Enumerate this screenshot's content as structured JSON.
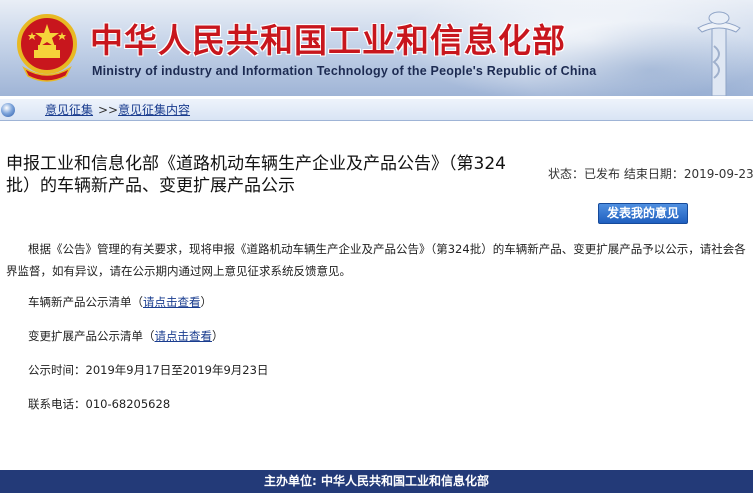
{
  "header": {
    "site_title": "中华人民共和国工业和信息化部",
    "site_subtitle": "Ministry of industry and Information Technology of the People's Republic of China"
  },
  "breadcrumb": {
    "items": [
      "意见征集",
      "意见征集内容"
    ],
    "separator": ">>"
  },
  "article": {
    "title": "申报工业和信息化部《道路机动车辆生产企业及产品公告》（第324批）的车辆新产品、变更扩展产品公示",
    "status_label": "状态：",
    "status_value": "已发布",
    "end_date_label": "结束日期：",
    "end_date_value": "2019-09-23",
    "comment_button": "发表我的意见",
    "intro": "根据《公告》管理的有关要求，现将申报《道路机动车辆生产企业及产品公告》（第324批）的车辆新产品、变更扩展产品予以公示，请社会各界监督，如有异议，请在公示期内通过网上意见征求系统反馈意见。",
    "new_list_label": "车辆新产品公示清单",
    "new_list_link": "请点击查看",
    "ext_list_label": "变更扩展产品公示清单",
    "ext_list_link": "请点击查看",
    "period_label": "公示时间：",
    "period_value": "2019年9月17日至2019年9月23日",
    "phone_label": "联系电话：",
    "phone_value": "010-68205628"
  },
  "footer": {
    "text": "主办单位: 中华人民共和国工业和信息化部"
  },
  "colors": {
    "title_red": "#c8161d",
    "footer_bg": "#233a78",
    "link": "#1a3d8f",
    "button": "#1f5fbf"
  }
}
